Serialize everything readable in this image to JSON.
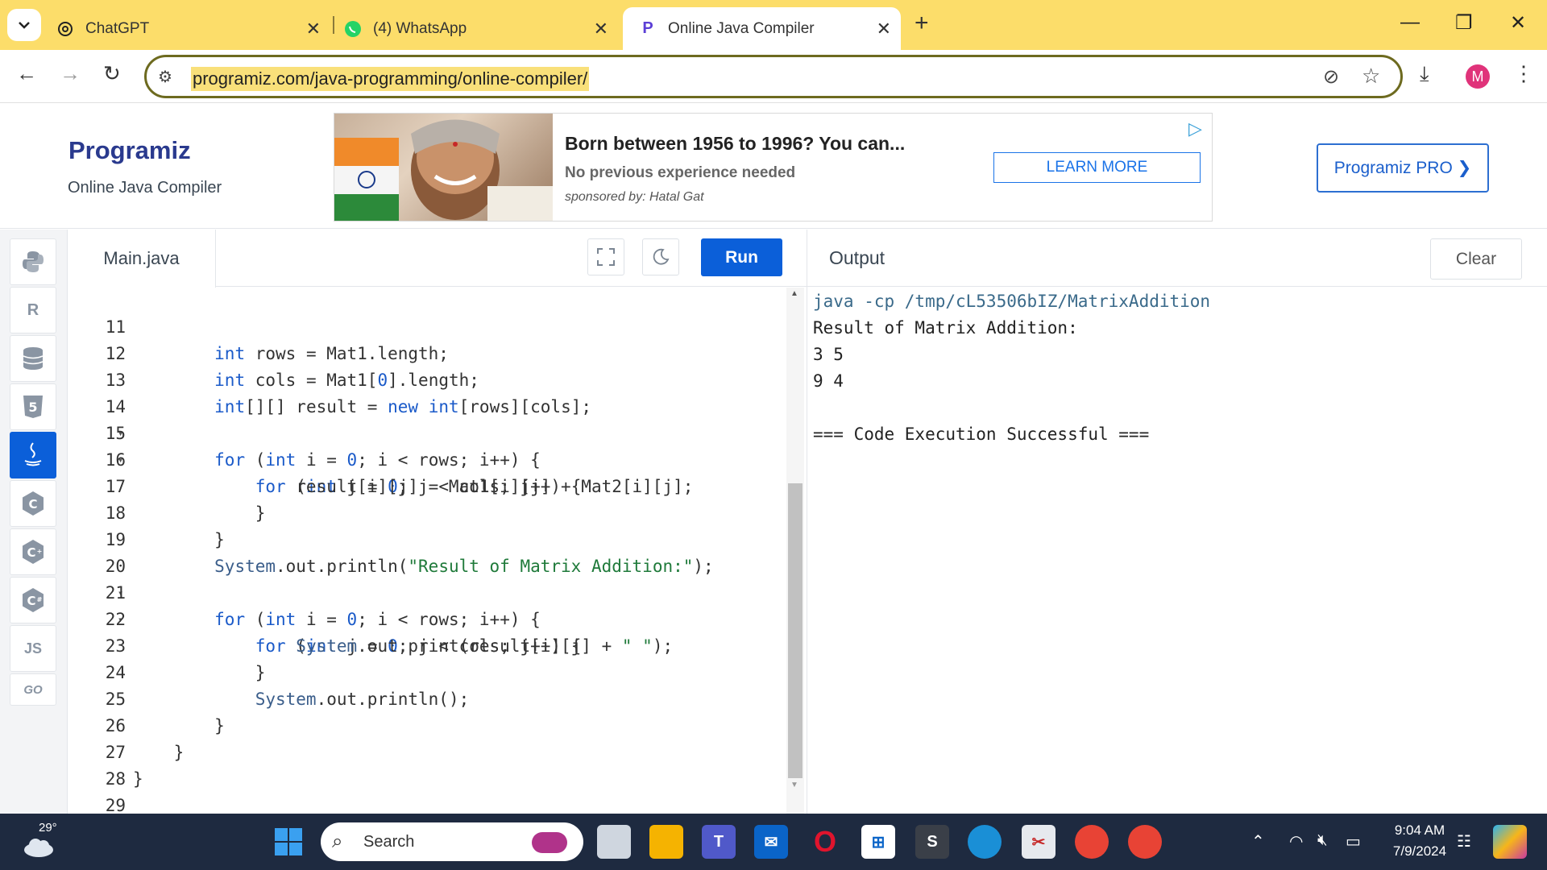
{
  "browser": {
    "tabs": [
      {
        "title": "ChatGPT"
      },
      {
        "title": "(4) WhatsApp"
      },
      {
        "title": "Online Java Compiler"
      }
    ],
    "url": "programiz.com/java-programming/online-compiler/",
    "profile_initial": "M"
  },
  "site": {
    "logo": "Programiz",
    "subtitle": "Online Java Compiler",
    "pro_button": "Programiz PRO ❯",
    "ad": {
      "title": "Born between 1956 to 1996? You can...",
      "subtitle": "No previous experience needed",
      "sponsor": "sponsored by: Hatal Gat",
      "cta": "LEARN MORE"
    }
  },
  "sidebar": {
    "languages": [
      {
        "name": "python",
        "label": "Py"
      },
      {
        "name": "r",
        "label": "R"
      },
      {
        "name": "sql",
        "label": "≡"
      },
      {
        "name": "html",
        "label": "5"
      },
      {
        "name": "java",
        "label": "☕"
      },
      {
        "name": "c",
        "label": "C"
      },
      {
        "name": "cpp",
        "label": "C+"
      },
      {
        "name": "csharp",
        "label": "C#"
      },
      {
        "name": "js",
        "label": "JS"
      },
      {
        "name": "go",
        "label": "GO"
      }
    ]
  },
  "editor": {
    "filename": "Main.java",
    "run_label": "Run",
    "lines": [
      {
        "n": "11",
        "code": "        int rows = Mat1.length;"
      },
      {
        "n": "12",
        "code": "        int cols = Mat1[0].length;"
      },
      {
        "n": "13",
        "code": "        int[][] result = new int[rows][cols];"
      },
      {
        "n": "14",
        "code": "        for (int i = 0; i < rows; i++) {"
      },
      {
        "n": "15",
        "code": "            for (int j = 0; j < cols; j++) {"
      },
      {
        "n": "16",
        "code": "                result[i][j] = Mat1[i][j] + Mat2[i][j];"
      },
      {
        "n": "17",
        "code": "            }"
      },
      {
        "n": "18",
        "code": "        }"
      },
      {
        "n": "19",
        "code": "        System.out.println(\"Result of Matrix Addition:\");"
      },
      {
        "n": "20",
        "code": "        for (int i = 0; i < rows; i++) {"
      },
      {
        "n": "21",
        "code": "            for (int j = 0; j < cols; j++) {"
      },
      {
        "n": "22",
        "code": "                System.out.print(result[i][j] + \" \");"
      },
      {
        "n": "23",
        "code": "            }"
      },
      {
        "n": "24",
        "code": "            System.out.println();"
      },
      {
        "n": "25",
        "code": "        }"
      },
      {
        "n": "26",
        "code": "    }"
      },
      {
        "n": "27",
        "code": "}"
      },
      {
        "n": "28",
        "code": ""
      },
      {
        "n": "29",
        "code": ""
      }
    ]
  },
  "output": {
    "title": "Output",
    "clear_label": "Clear",
    "command": "java -cp /tmp/cL53506bIZ/MatrixAddition",
    "lines": [
      "Result of Matrix Addition:",
      "3 5",
      "9 4",
      "",
      "=== Code Execution Successful ==="
    ]
  },
  "taskbar": {
    "weather": "29°",
    "search_placeholder": "Search",
    "time": "9:04 AM",
    "date": "7/9/2024"
  }
}
